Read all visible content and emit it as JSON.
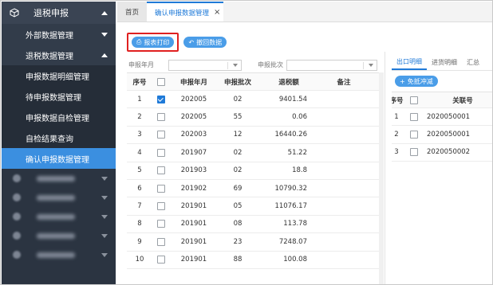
{
  "sidebar": {
    "top": {
      "label": "退税申报"
    },
    "groups": [
      {
        "label": "外部数据管理"
      },
      {
        "label": "退税数据管理"
      }
    ],
    "leaves": [
      {
        "label": "申报数据明细管理"
      },
      {
        "label": "待申报数据管理"
      },
      {
        "label": "申报数据自检管理"
      },
      {
        "label": "自检结果查询"
      },
      {
        "label": "确认申报数据管理"
      }
    ]
  },
  "tabs": [
    {
      "label": "首页"
    },
    {
      "label": "确认申报数据管理"
    }
  ],
  "toolbar": {
    "print_label": "报表打印",
    "withdraw_label": "撤回数据"
  },
  "filters": {
    "month_label": "申报年月",
    "batch_label": "申报批次"
  },
  "table": {
    "columns": [
      "序号",
      "申报年月",
      "申报批次",
      "退税额",
      "备注"
    ],
    "rows": [
      {
        "idx": "1",
        "checked": true,
        "ym": "202005",
        "batch": "02",
        "amount": "9401.54",
        "note": ""
      },
      {
        "idx": "2",
        "checked": false,
        "ym": "202005",
        "batch": "55",
        "amount": "0.06",
        "note": ""
      },
      {
        "idx": "3",
        "checked": false,
        "ym": "202003",
        "batch": "12",
        "amount": "16440.26",
        "note": ""
      },
      {
        "idx": "4",
        "checked": false,
        "ym": "201907",
        "batch": "02",
        "amount": "51.22",
        "note": ""
      },
      {
        "idx": "5",
        "checked": false,
        "ym": "201903",
        "batch": "02",
        "amount": "18.8",
        "note": ""
      },
      {
        "idx": "6",
        "checked": false,
        "ym": "201902",
        "batch": "69",
        "amount": "10790.32",
        "note": ""
      },
      {
        "idx": "7",
        "checked": false,
        "ym": "201901",
        "batch": "05",
        "amount": "11076.17",
        "note": ""
      },
      {
        "idx": "8",
        "checked": false,
        "ym": "201901",
        "batch": "08",
        "amount": "113.78",
        "note": ""
      },
      {
        "idx": "9",
        "checked": false,
        "ym": "201901",
        "batch": "23",
        "amount": "7248.07",
        "note": ""
      },
      {
        "idx": "10",
        "checked": false,
        "ym": "201901",
        "batch": "88",
        "amount": "100.08",
        "note": ""
      }
    ]
  },
  "right": {
    "tabs": [
      "出口明细",
      "进货明细",
      "汇总"
    ],
    "button_label": "免抵冲减",
    "columns": [
      "序号",
      "关联号"
    ],
    "rows": [
      {
        "idx": "1",
        "no": "2020050001"
      },
      {
        "idx": "2",
        "no": "2020050001"
      },
      {
        "idx": "3",
        "no": "2020050002"
      }
    ]
  },
  "colors": {
    "accent": "#1f7ad8",
    "sidebar_bg": "#2b3441",
    "active_item": "#3b8fe0",
    "highlight": "#e02020"
  }
}
